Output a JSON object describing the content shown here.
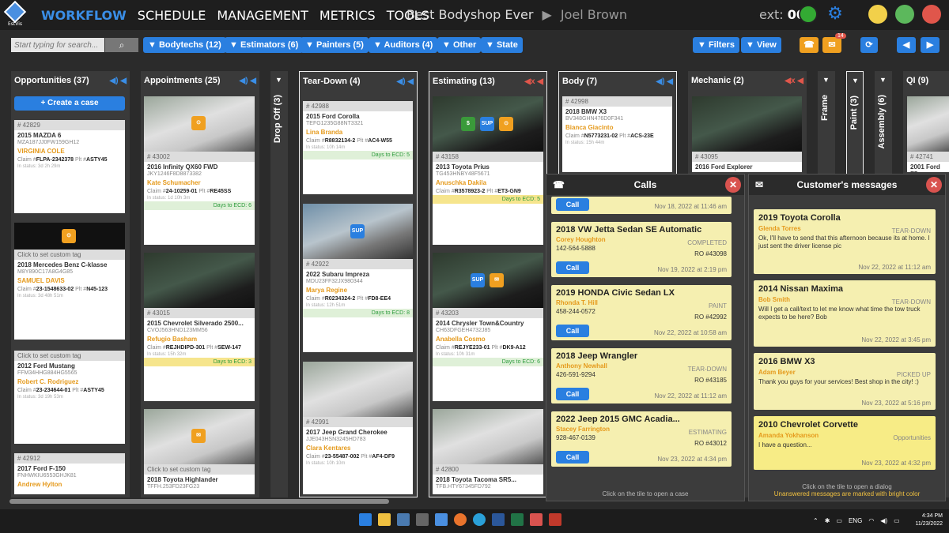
{
  "app": {
    "logo_text": "EstVis",
    "shop": "Best Bodyshop Ever",
    "user": "Joel Brown",
    "ext_label": "ext:",
    "ext_value": "006",
    "mail_badge": "14"
  },
  "nav": [
    "WORKFLOW",
    "SCHEDULE",
    "MANAGEMENT",
    "METRICS",
    "TOOLS"
  ],
  "filters": {
    "search_placeholder": "Start typing for search...",
    "buttons": [
      "▼ Bodytechs (12)",
      "▼ Estimators (6)",
      "▼ Painters (5)",
      "▼ Auditors (4)",
      "▼ Other",
      "▼ State"
    ],
    "right": [
      "▼ Filters",
      "▼ View"
    ]
  },
  "columns": {
    "opportunities": {
      "title": "Opportunities (37)",
      "create": "+ Create a case"
    },
    "appointments": {
      "title": "Appointments (25)"
    },
    "dropoff": {
      "title": "Drop Off (3)"
    },
    "teardown": {
      "title": "Tear-Down (4)"
    },
    "estimating": {
      "title": "Estimating (13)"
    },
    "body": {
      "title": "Body (7)"
    },
    "mechanic": {
      "title": "Mechanic (2)"
    },
    "frame": {
      "title": "Frame"
    },
    "paint": {
      "title": "Paint (3)"
    },
    "assembly": {
      "title": "Assembly (6)"
    },
    "qi": {
      "title": "QI (9)"
    }
  },
  "cards": {
    "opp1": {
      "num": "# 42829",
      "car": "2015 MAZDA 6",
      "tag": "MY",
      "vin": "MZA187JJ0FW159GH12",
      "person": "VIRGINIA COLE",
      "claim": "FLPA-2342378",
      "plt": "ASTY45",
      "status": "In status: 3d 2h 29m"
    },
    "opp2": {
      "custom": "Click to set custom tag",
      "car": "2018 Mercedes Benz C-klasse",
      "tag": "SF",
      "vin": "M8Y890C17A8G4G85",
      "person": "SAMUEL DAVIS",
      "claim": "23-1548633-02",
      "plt": "N45-123",
      "status": "In status: 3d 48h 51m"
    },
    "opp3": {
      "custom": "Click to set custom tag",
      "car": "2012 Ford Mustang",
      "tag": "IF",
      "vin": "FFM34HHG884HG5565",
      "person": "Robert C. Rodriguez",
      "claim": "23-234644-01",
      "plt": "ASTY45",
      "status": "In status: 3d 19h 53m"
    },
    "opp4": {
      "num": "# 42912",
      "car": "2017 Ford F-150",
      "tag": "MY",
      "vin": "FNHWKIU6553GHJK81",
      "person": "Andrew Hylton"
    },
    "app1": {
      "num": "# 43002",
      "car": "2016 Infinity QX60 FWD",
      "tag": "SF",
      "vin": "JKY1246F8D8873382",
      "person": "Kate Schumacher",
      "claim": "24-10259-01",
      "plt": "RE45SS",
      "status": "In status: 1d 10h 3m",
      "ecd": "Days to ECD: 6"
    },
    "app2": {
      "num": "# 43015",
      "car": "2015 Chevrolet Silverado 2500...",
      "tag": "MY",
      "vin": "CVOJ563HND123MM56",
      "person": "Refugio Basham",
      "claim": "REJHDIPD-301",
      "plt": "SEW-147",
      "status": "In status: 15h 32m",
      "ecd": "Days to ECD: 3"
    },
    "app3": {
      "custom": "Click to set custom tag",
      "car": "2018 Toyota Highlander",
      "tag": "MY",
      "vin": "TFFH.253FD23FG23"
    },
    "td1": {
      "num": "# 42988",
      "car": "2015 Ford Corolla",
      "tag": "TEB",
      "vin": "TEFG1235G88NT3321",
      "person": "Lina Branda",
      "claim": "R8832134-2",
      "plt": "AC4-W55",
      "status": "In status: 10h 14m",
      "ecd": "Days to ECD: 5"
    },
    "td2": {
      "num": "# 42922",
      "car": "2022 Subaru Impreza",
      "tag": "TEB",
      "vin": "MDU23FF32JX980344",
      "person": "Marya Regine",
      "claim": "R0234324-2",
      "plt": "FD8-EE4",
      "status": "In status: 12h 51m",
      "ecd": "Days to ECD: 8"
    },
    "td3": {
      "num": "# 42991",
      "car": "2017 Jeep Grand Cherokee",
      "tag": "IF",
      "vin": "JJE043HSN3245HD783",
      "person": "Clara Kentares",
      "claim": "23-55487-002",
      "plt": "AF4-DF9",
      "status": "In status: 10h 10m"
    },
    "est1": {
      "num": "# 43158",
      "car": "2013 Toyota Prius",
      "tag": "TEB",
      "vin": "TG453HNBY48F5671",
      "person": "Anuschka Dakila",
      "claim": "R3578923-2",
      "plt": "ET3-GN9",
      "ecd": "Days to ECD: 5"
    },
    "est2": {
      "num": "# 43203",
      "car": "2014 Chrysler Town&Country",
      "tag": "MY",
      "vin": "CH63DFGEH4732J85",
      "person": "Anabella Cosmo",
      "claim": "REJYE233-01",
      "plt": "DK9-A12",
      "status": "In status: 10h 31m",
      "ecd": "Days to ECD: 6"
    },
    "est3": {
      "num": "# 42800",
      "car": "2018 Toyota Tacoma SR5...",
      "tag": "TEB",
      "vin": "TFB.HTY67345FD792"
    },
    "body1": {
      "num": "# 42998",
      "car": "2018 BMW X3",
      "tag": "GC",
      "vin": "BV348GHN476D0F341",
      "person": "Bianca Giacinto",
      "claim": "N5773231-02",
      "plt": "ACS-23E",
      "status": "In status: 15h 44m"
    },
    "mech1": {
      "num": "# 43095",
      "car": "2016 Ford Explorer"
    },
    "qi1": {
      "num": "# 42741",
      "car": "2001 Ford F5"
    }
  },
  "calls": {
    "title": "Calls",
    "items": [
      {
        "date": "Nov 18, 2022 at 11:46 am"
      },
      {
        "title": "2018 VW Jetta Sedan SE Automatic",
        "name": "Corey Houghton",
        "status": "COMPLETED",
        "phone": "142-564-5888",
        "ro": "RO #43098",
        "date": "Nov 19, 2022 at 2:19 pm"
      },
      {
        "title": "2019 HONDA Civic Sedan LX",
        "name": "Rhonda T. Hill",
        "status": "PAINT",
        "phone": "458-244-0572",
        "ro": "RO #42992",
        "date": "Nov 22, 2022 at 10:58 am"
      },
      {
        "title": "2018 Jeep Wrangler",
        "name": "Anthony Newhall",
        "status": "TEAR-DOWN",
        "phone": "426-591-9294",
        "ro": "RO #43185",
        "date": "Nov 22, 2022 at 11:12 am"
      },
      {
        "title": "2022 Jeep 2015 GMC Acadia...",
        "name": "Stacey Farrington",
        "status": "ESTIMATING",
        "phone": "928-467-0139",
        "ro": "RO #43012",
        "date": "Nov 23, 2022 at 4:34 pm"
      }
    ],
    "call_label": "Call",
    "footer": "Click on the tile to open a case"
  },
  "messages": {
    "title": "Customer's messages",
    "items": [
      {
        "title": "2019 Toyota Corolla",
        "name": "Glenda Torres",
        "status": "TEAR-DOWN",
        "msg": "Ok, I'll have to send that this afternoon because its at home. I just sent the driver license pic",
        "date": "Nov 22, 2022 at 11:12 am"
      },
      {
        "title": "2014 Nissan Maxima",
        "name": "Bob Smith",
        "status": "TEAR-DOWN",
        "msg": "Will I get a call/text to let me know what time the tow truck expects to be here? Bob",
        "date": "Nov 22, 2022 at 3:45 pm"
      },
      {
        "title": "2016 BMW X3",
        "name": "Adam Beyer",
        "status": "PICKED UP",
        "msg": "Thank you guys for your services! Best shop in the city! :)",
        "date": "Nov 23, 2022 at 5:16 pm"
      },
      {
        "title": "2010 Chevrolet Corvette",
        "name": "Amanda Yokhanson",
        "status": "Opportunities",
        "msg": "I have a question...",
        "date": "Nov 23, 2022 at 4:32 pm"
      }
    ],
    "footer1": "Click on the tile to open a dialog",
    "footer2": "Unanswered messages are marked with bright color"
  },
  "taskbar": {
    "lang": "ENG",
    "time": "4:34 PM",
    "date": "11/23/2022"
  }
}
